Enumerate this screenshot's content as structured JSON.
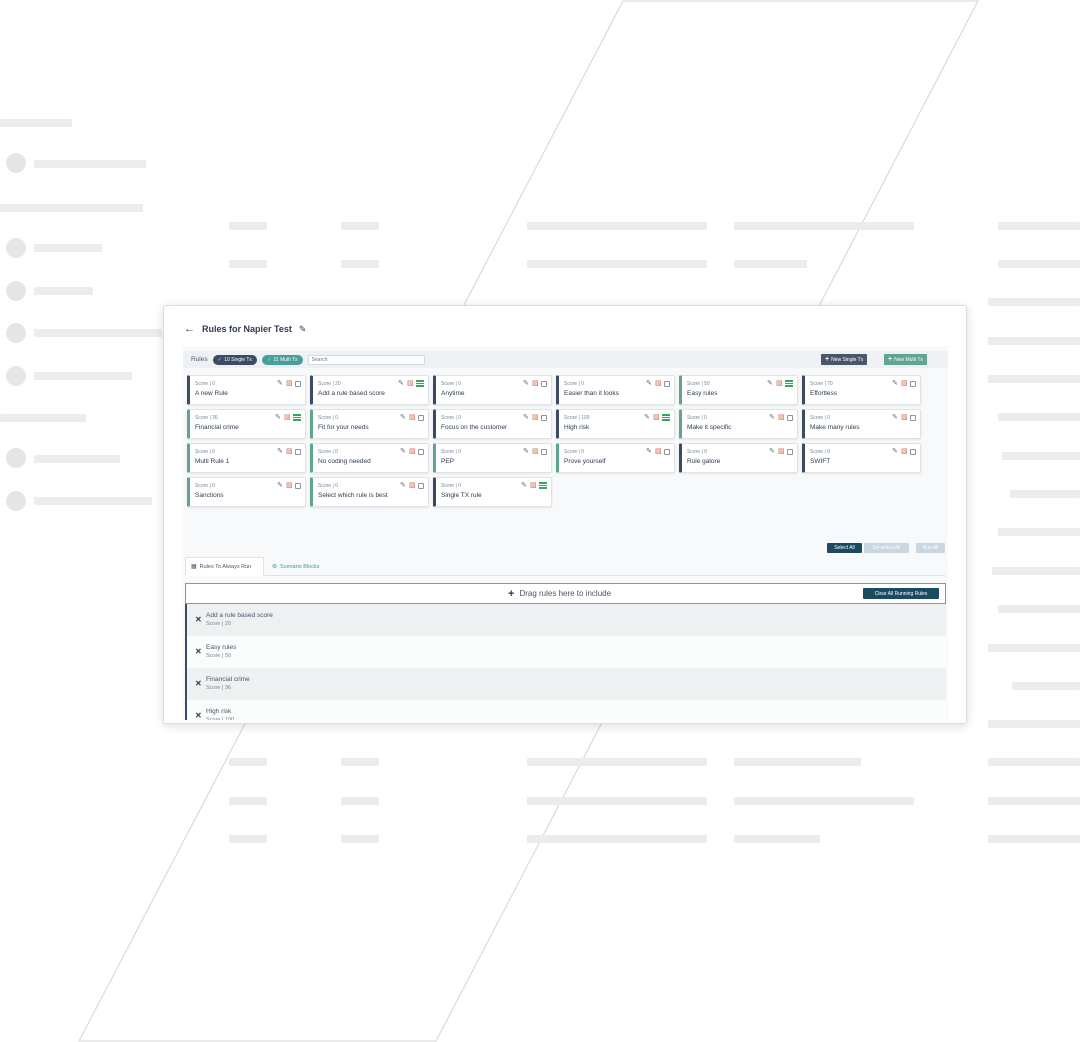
{
  "page": {
    "title": "Rules for Napier Test",
    "back_icon": "arrow-left-icon",
    "edit_icon": "edit-icon"
  },
  "toolbar": {
    "rules_label": "Rules",
    "single_filter": "10 Single Tx",
    "multi_filter": "11 Multi Tx",
    "search_placeholder": "Search",
    "new_single": "New Single Tx",
    "new_multi": "New Multi Tx"
  },
  "cards": [
    {
      "score": "Score | 0",
      "name": "A new Rule",
      "multi": false
    },
    {
      "score": "Score | 20",
      "name": "Add a rule based score",
      "multi": false,
      "running": true
    },
    {
      "score": "Score | 0",
      "name": "Anytime",
      "multi": false
    },
    {
      "score": "Score | 0",
      "name": "Easier than it looks",
      "multi": false
    },
    {
      "score": "Score | 50",
      "name": "Easy rules",
      "multi": true,
      "running": true
    },
    {
      "score": "Score | 70",
      "name": "Effortless",
      "multi": false
    },
    {
      "score": "Score | 36",
      "name": "Financial crime",
      "multi": true,
      "running": true
    },
    {
      "score": "Score | 0",
      "name": "Fit for your needs",
      "multi": true
    },
    {
      "score": "Score | 0",
      "name": "Focus on the customer",
      "multi": false
    },
    {
      "score": "Score | 100",
      "name": "High risk",
      "multi": false,
      "running": true
    },
    {
      "score": "Score | 0",
      "name": "Make it specific",
      "multi": true
    },
    {
      "score": "Score | 0",
      "name": "Make many rules",
      "multi": false
    },
    {
      "score": "Score | 0",
      "name": "Multi Rule 1",
      "multi": true
    },
    {
      "score": "Score | 0",
      "name": "No coding needed",
      "multi": true
    },
    {
      "score": "Score | 0",
      "name": "PEP",
      "multi": true
    },
    {
      "score": "Score | 0",
      "name": "Prove yourself",
      "multi": true
    },
    {
      "score": "Score | 0",
      "name": "Rule galore",
      "multi": false
    },
    {
      "score": "Score | 0",
      "name": "SWIFT",
      "multi": false
    },
    {
      "score": "Score | 0",
      "name": "Sanctions",
      "multi": true
    },
    {
      "score": "Score | 0",
      "name": "Select which rule is best",
      "multi": true
    },
    {
      "score": "Score | 0",
      "name": "Single TX rule",
      "multi": false,
      "running": true
    }
  ],
  "actions": {
    "select_all": "Select All",
    "deselect_all": "De-select All",
    "run_all": "Run All"
  },
  "tabs": {
    "always_run": "Rules To Always Run",
    "scenario_blocks": "Scenario Blocks"
  },
  "dropzone": {
    "text": "Drag rules here to include",
    "clear_button": "Clear All Running Rules"
  },
  "running_rules": [
    {
      "name": "Add a rule based score",
      "score": "Score | 20"
    },
    {
      "name": "Easy rules",
      "score": "Score | 50"
    },
    {
      "name": "Financial crime",
      "score": "Score | 36"
    },
    {
      "name": "High risk",
      "score": "Score | 100"
    }
  ],
  "colors": {
    "single_accent": "#3d4a63",
    "multi_accent": "#5fa58f",
    "primary_button": "#1b4b5e",
    "delete_icon": "#d06a4a",
    "running_icon": "#2eaa5a"
  }
}
